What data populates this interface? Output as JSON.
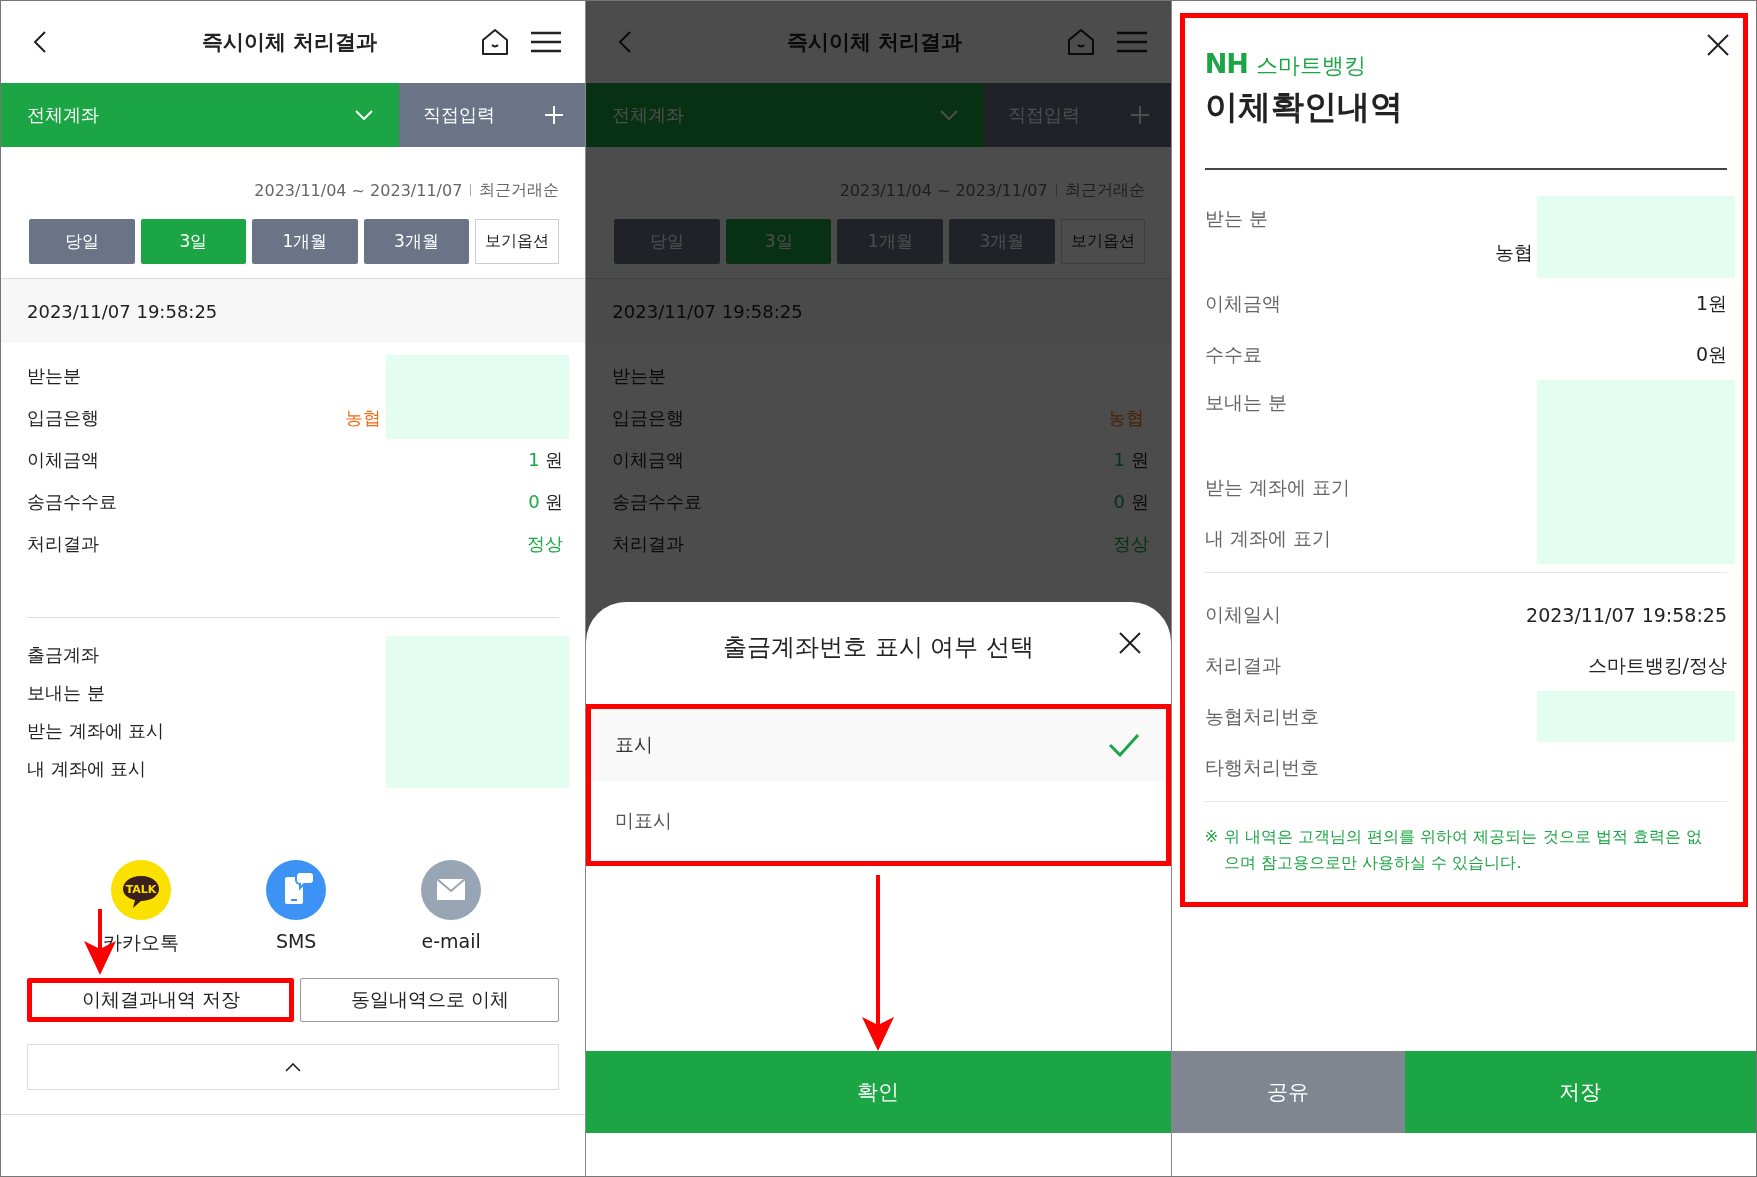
{
  "screens": [
    {
      "kind": "result",
      "title": "즉시이체 처리결과",
      "tabs": [
        {
          "label": "전체계좌",
          "kind": "dropdown",
          "selected": true
        },
        {
          "label": "직접입력",
          "kind": "add",
          "selected": false
        }
      ],
      "date_range": "2023/11/04 ~ 2023/11/07",
      "sort": "최근거래순",
      "periods": [
        {
          "label": "당일",
          "selected": false
        },
        {
          "label": "3일",
          "selected": true
        },
        {
          "label": "1개월",
          "selected": false
        },
        {
          "label": "3개월",
          "selected": false
        }
      ],
      "view_options": "보기옵션",
      "timestamp": "2023/11/07 19:58:25",
      "sections": [
        [
          {
            "label": "받는분",
            "kind": "text",
            "redacted": true
          },
          {
            "label": "입금은행",
            "kind": "bank",
            "value": "농협",
            "redacted": true
          },
          {
            "label": "이체금액",
            "kind": "amount",
            "value": "1",
            "unit": "원"
          },
          {
            "label": "송금수수료",
            "kind": "amount",
            "value": "0",
            "unit": "원"
          },
          {
            "label": "처리결과",
            "kind": "status",
            "value": "정상"
          }
        ],
        [
          {
            "label": "출금계좌",
            "kind": "text",
            "redacted": true
          },
          {
            "label": "보내는 분",
            "kind": "text",
            "redacted": true
          },
          {
            "label": "받는 계좌에 표시",
            "kind": "text",
            "redacted": true
          },
          {
            "label": "내 계좌에 표시",
            "kind": "text",
            "redacted": true
          }
        ]
      ],
      "share": [
        {
          "label": "카카오톡",
          "kind": "kakao",
          "icon_text": "TALK"
        },
        {
          "label": "SMS",
          "kind": "sms"
        },
        {
          "label": "e-mail",
          "kind": "email"
        }
      ],
      "actions": [
        {
          "label": "이체결과내역 저장",
          "highlighted": true
        },
        {
          "label": "동일내역으로 이체",
          "highlighted": false
        }
      ],
      "arrow": true
    },
    {
      "kind": "sheet",
      "background": {
        "title": "즉시이체 처리결과",
        "tabs": [
          {
            "label": "전체계좌",
            "kind": "dropdown",
            "selected": true
          },
          {
            "label": "직접입력",
            "kind": "add",
            "selected": false
          }
        ],
        "date_range": "2023/11/04 ~ 2023/11/07",
        "sort": "최근거래순",
        "periods": [
          {
            "label": "당일",
            "selected": false
          },
          {
            "label": "3일",
            "selected": true
          },
          {
            "label": "1개월",
            "selected": false
          },
          {
            "label": "3개월",
            "selected": false
          }
        ],
        "view_options": "보기옵션",
        "timestamp": "2023/11/07 19:58:25",
        "sections": [
          [
            {
              "label": "받는분",
              "kind": "text"
            },
            {
              "label": "입금은행",
              "kind": "bank",
              "value": "농협"
            },
            {
              "label": "이체금액",
              "kind": "amount",
              "value": "1",
              "unit": "원"
            },
            {
              "label": "송금수수료",
              "kind": "amount",
              "value": "0",
              "unit": "원"
            },
            {
              "label": "처리결과",
              "kind": "status",
              "value": "정상"
            }
          ]
        ]
      },
      "sheet": {
        "title": "출금계좌번호 표시 여부 선택",
        "options_highlighted": true,
        "options": [
          {
            "label": "표시",
            "selected": true
          },
          {
            "label": "미표시",
            "selected": false
          }
        ],
        "confirm": "확인"
      },
      "arrow": true
    },
    {
      "kind": "receipt",
      "highlighted": true,
      "brand_mark": "NH",
      "brand_name": "스마트뱅킹",
      "title": "이체확인내역",
      "groups": [
        [
          {
            "label": "받는 분",
            "kind": "stacked",
            "value": "농협",
            "redacted": true
          },
          {
            "label": "이체금액",
            "kind": "text",
            "value": "1원"
          },
          {
            "label": "수수료",
            "kind": "text",
            "value": "0원"
          },
          {
            "label": "보내는 분",
            "kind": "stacked",
            "redacted": true
          },
          {
            "label": "받는 계좌에 표기",
            "kind": "text",
            "redacted": true
          },
          {
            "label": "내 계좌에 표기",
            "kind": "text",
            "redacted": true
          }
        ],
        [
          {
            "label": "이체일시",
            "kind": "text",
            "value": "2023/11/07 19:58:25"
          },
          {
            "label": "처리결과",
            "kind": "text",
            "value": "스마트뱅킹/정상"
          },
          {
            "label": "농협처리번호",
            "kind": "text",
            "redacted": true
          },
          {
            "label": "타행처리번호",
            "kind": "text"
          }
        ]
      ],
      "notice_mark": "※",
      "notice": "위 내역은 고객님의 편의를 위하여 제공되는 것으로 법적 효력은 없으며 참고용으로만 사용하실 수 있습니다.",
      "buttons": [
        {
          "label": "공유",
          "kind": "secondary"
        },
        {
          "label": "저장",
          "kind": "primary"
        }
      ]
    }
  ]
}
